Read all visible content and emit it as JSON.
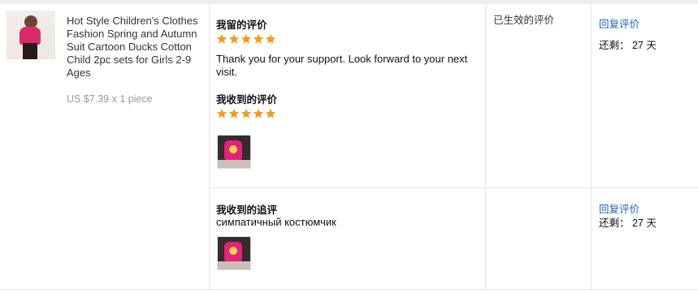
{
  "product": {
    "title": "Hot Style Children's Clothes Fashion Spring and Autumn Suit Cartoon Ducks Cotton Child 2pc sets for Girls 2-9 Ages",
    "price_line": "US $7.39 x 1 piece",
    "thumbnail_icon": "product-thumbnail"
  },
  "feedback_given": {
    "label": "我留的评价",
    "rating": 5,
    "text": "Thank you for your support. Look forward to your next visit."
  },
  "feedback_received": {
    "label": "我收到的评价",
    "rating": 5,
    "photo_icon": "review-photo"
  },
  "status_text": "已生效的评价",
  "reply_link": "回复评价",
  "remaining": "还剩： 27 天",
  "followup": {
    "label": "我收到的追评",
    "text": "симпатичный костюмчик",
    "photo_icon": "review-photo",
    "reply_link": "回复评价",
    "remaining": "还剩： 27 天"
  },
  "colors": {
    "star": "#f29b1f",
    "link": "#1a62b4",
    "border": "#e6e6e6"
  }
}
